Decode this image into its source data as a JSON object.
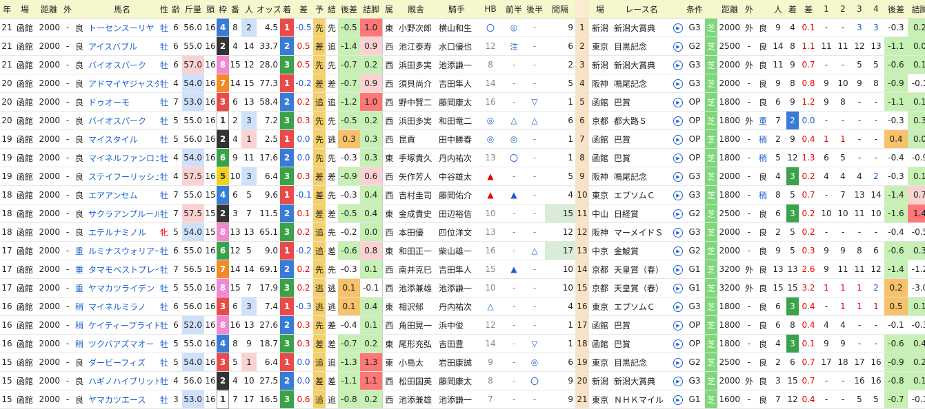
{
  "headers": [
    "年",
    "場",
    "距離",
    "外",
    "",
    "馬名",
    "性",
    "齢",
    "斤量",
    "頭",
    "枠",
    "番",
    "人",
    "オッズ",
    "着",
    "差",
    "予",
    "結",
    "後差",
    "詰脚",
    "属",
    "厩舎",
    "騎手",
    "HB",
    "前半",
    "後半",
    "間隔",
    "",
    "場",
    "レース名",
    "",
    "条件",
    "",
    "距離",
    "外",
    "",
    "人",
    "着",
    "差",
    "1",
    "2",
    "3",
    "4",
    "後差",
    "詰脚"
  ],
  "colors": {
    "waku": {
      "1": "#ffffff",
      "2": "#333333",
      "3": "#e94b4b",
      "4": "#3a7bd5",
      "5": "#f2d21b",
      "6": "#3aa34a",
      "7": "#f08a2a",
      "8": "#f08ad0"
    },
    "chaku": {
      "1": "#e94b4b",
      "2": "#3a7bd5",
      "3": "#3aa34a"
    }
  },
  "rows": [
    {
      "yr": "21",
      "ba": "函館",
      "dist": "2000",
      "soto": "-",
      "baba": "良",
      "name": "トーセンスーリヤ",
      "sex": "牡",
      "age": "6",
      "kin": "56.0",
      "tou": "16",
      "waku": "4",
      "ban": "8",
      "nin": "2",
      "odds": "4.5",
      "chaku": "1",
      "sa": "-0.5",
      "yoso": "先",
      "kek": "先",
      "kosa": "-0.5",
      "tume": "1.0",
      "zoku": "東",
      "kyu": "小野次郎",
      "kishu": "横山和生",
      "hb": "〇",
      "zen": "◎",
      "kou": "-",
      "kan": "9",
      "no": "1",
      "ba2": "新潟",
      "race": "新潟大賞典",
      "jo": "G3",
      "shiba": "芝",
      "dist2": "2000",
      "soto2": "外",
      "baba2": "良",
      "nin2": "9",
      "chaku2": "4",
      "sa2": "0.1",
      "c1": "-",
      "c2": "-",
      "c3": "3",
      "c4": "3",
      "kosa2": "-0.3",
      "tume2": "0.2"
    },
    {
      "yr": "21",
      "ba": "函館",
      "dist": "2000",
      "soto": "-",
      "baba": "良",
      "name": "アイスバブル",
      "sex": "牡",
      "age": "6",
      "kin": "55.0",
      "tou": "16",
      "waku": "2",
      "ban": "4",
      "nin": "14",
      "odds": "33.7",
      "chaku": "2",
      "sa": "0.5",
      "yoso": "差",
      "kek": "追",
      "kosa": "-1.4",
      "tume": "0.9",
      "zoku": "西",
      "kyu": "池江泰寿",
      "kishu": "水口優也",
      "hb": "12",
      "zen": "注",
      "kou": "-",
      "kan": "6",
      "no": "2",
      "ba2": "東京",
      "race": "目黒記念",
      "jo": "G2",
      "shiba": "芝",
      "dist2": "2500",
      "soto2": "-",
      "baba2": "良",
      "nin2": "14",
      "chaku2": "8",
      "sa2": "1.1",
      "c1": "11",
      "c2": "11",
      "c3": "12",
      "c4": "13",
      "kosa2": "-1.1",
      "tume2": "0.0"
    },
    {
      "yr": "21",
      "ba": "函館",
      "dist": "2000",
      "soto": "-",
      "baba": "良",
      "name": "バイオスパーク",
      "sex": "牡",
      "age": "6",
      "kin": "57.0",
      "tou": "16",
      "waku": "8",
      "ban": "15",
      "nin": "12",
      "odds": "28.0",
      "chaku": "3",
      "sa": "0.5",
      "yoso": "先",
      "kek": "先",
      "kosa": "-0.7",
      "tume": "0.2",
      "zoku": "西",
      "kyu": "浜田多実",
      "kishu": "池添謙一",
      "hb": "8",
      "zen": "-",
      "kou": "-",
      "kan": "2",
      "no": "3",
      "ba2": "新潟",
      "race": "新潟大賞典",
      "jo": "G3",
      "shiba": "芝",
      "dist2": "2000",
      "soto2": "外",
      "baba2": "良",
      "nin2": "11",
      "chaku2": "9",
      "sa2": "0.7",
      "c1": "-",
      "c2": "-",
      "c3": "5",
      "c4": "5",
      "kosa2": "-0.6",
      "tume2": "0.1"
    },
    {
      "yr": "20",
      "ba": "函館",
      "dist": "2000",
      "soto": "-",
      "baba": "良",
      "name": "アドマイヤジャスタ",
      "sex": "牡",
      "age": "4",
      "kin": "54.0",
      "tou": "16",
      "waku": "7",
      "ban": "14",
      "nin": "15",
      "odds": "77.3",
      "chaku": "1",
      "sa": "-0.2",
      "yoso": "差",
      "kek": "差",
      "kosa": "-0.7",
      "tume": "0.9",
      "zoku": "西",
      "kyu": "須貝尚介",
      "kishu": "吉田隼人",
      "hb": "14",
      "zen": "-",
      "kou": "-",
      "kan": "5",
      "no": "4",
      "ba2": "阪神",
      "race": "鳴尾記念",
      "jo": "G3",
      "shiba": "芝",
      "dist2": "2000",
      "soto2": "-",
      "baba2": "良",
      "nin2": "9",
      "chaku2": "8",
      "sa2": "0.8",
      "c1": "9",
      "c2": "10",
      "c3": "9",
      "c4": "8",
      "kosa2": "-0.9",
      "tume2": "-0.1"
    },
    {
      "yr": "20",
      "ba": "函館",
      "dist": "2000",
      "soto": "-",
      "baba": "良",
      "name": "ドゥオーモ",
      "sex": "牡",
      "age": "7",
      "kin": "53.0",
      "tou": "16",
      "waku": "3",
      "ban": "6",
      "nin": "13",
      "odds": "58.4",
      "chaku": "2",
      "sa": "0.2",
      "yoso": "追",
      "kek": "追",
      "kosa": "-1.2",
      "tume": "1.0",
      "zoku": "西",
      "kyu": "野中賢二",
      "kishu": "藤岡康太",
      "hb": "16",
      "zen": "-",
      "kou": "▽",
      "kan": "1",
      "no": "5",
      "ba2": "函館",
      "race": "巴賞",
      "jo": "OP",
      "shiba": "芝",
      "dist2": "1800",
      "soto2": "-",
      "baba2": "良",
      "nin2": "6",
      "chaku2": "9",
      "sa2": "1.2",
      "c1": "9",
      "c2": "8",
      "c3": "-",
      "c4": "-",
      "kosa2": "-1.1",
      "tume2": "0.1"
    },
    {
      "yr": "20",
      "ba": "函館",
      "dist": "2000",
      "soto": "-",
      "baba": "良",
      "name": "バイオスパーク",
      "sex": "牡",
      "age": "5",
      "kin": "55.0",
      "tou": "16",
      "waku": "1",
      "ban": "2",
      "nin": "3",
      "odds": "7.2",
      "chaku": "3",
      "sa": "0.3",
      "yoso": "先",
      "kek": "先",
      "kosa": "-0.5",
      "tume": "0.2",
      "zoku": "西",
      "kyu": "浜田多実",
      "kishu": "和田竜二",
      "hb": "◎",
      "zen": "△",
      "kou": "△",
      "kan": "6",
      "no": "6",
      "ba2": "京都",
      "race": "都大路Ｓ",
      "jo": "OP",
      "shiba": "芝",
      "dist2": "1800",
      "soto2": "外",
      "baba2": "重",
      "nin2": "7",
      "chaku2": "2",
      "sa2": "0.0",
      "c1": "-",
      "c2": "-",
      "c3": "-",
      "c4": "-",
      "kosa2": "-0.3",
      "tume2": "0.3"
    },
    {
      "yr": "19",
      "ba": "函館",
      "dist": "2000",
      "soto": "-",
      "baba": "良",
      "name": "マイスタイル",
      "sex": "牡",
      "age": "5",
      "kin": "56.0",
      "tou": "16",
      "waku": "2",
      "ban": "4",
      "nin": "1",
      "odds": "2.5",
      "chaku": "1",
      "sa": "0.0",
      "yoso": "先",
      "kek": "逃",
      "kosa": "0.3",
      "tume": "0.3",
      "zoku": "西",
      "kyu": "昆貢",
      "kishu": "田中勝春",
      "hb": "◎",
      "zen": "◎",
      "kou": "-",
      "kan": "1",
      "no": "7",
      "ba2": "函館",
      "race": "巴賞",
      "jo": "OP",
      "shiba": "芝",
      "dist2": "1800",
      "soto2": "-",
      "baba2": "稍",
      "nin2": "2",
      "chaku2": "9",
      "sa2": "0.4",
      "c1": "1",
      "c2": "1",
      "c3": "-",
      "c4": "-",
      "kosa2": "0.4",
      "tume2": "0.0"
    },
    {
      "yr": "19",
      "ba": "函館",
      "dist": "2000",
      "soto": "-",
      "baba": "良",
      "name": "マイネルファンロン",
      "sex": "牡",
      "age": "4",
      "kin": "54.0",
      "tou": "16",
      "waku": "6",
      "ban": "9",
      "nin": "11",
      "odds": "17.6",
      "chaku": "2",
      "sa": "0.0",
      "yoso": "先",
      "kek": "先",
      "kosa": "-0.3",
      "tume": "0.3",
      "zoku": "東",
      "kyu": "手塚貴久",
      "kishu": "丹内祐次",
      "hb": "13",
      "zen": "〇",
      "kou": "-",
      "kan": "1",
      "no": "8",
      "ba2": "函館",
      "race": "巴賞",
      "jo": "OP",
      "shiba": "芝",
      "dist2": "1800",
      "soto2": "-",
      "baba2": "稍",
      "nin2": "5",
      "chaku2": "12",
      "sa2": "1.3",
      "c1": "6",
      "c2": "5",
      "c3": "-",
      "c4": "-",
      "kosa2": "-0.4",
      "tume2": "-0.9"
    },
    {
      "yr": "19",
      "ba": "函館",
      "dist": "2000",
      "soto": "-",
      "baba": "良",
      "name": "ステイフーリッシュ",
      "sex": "牡",
      "age": "4",
      "kin": "57.5",
      "tou": "16",
      "waku": "5",
      "ban": "10",
      "nin": "3",
      "odds": "6.4",
      "chaku": "3",
      "sa": "0.3",
      "yoso": "差",
      "kek": "差",
      "kosa": "-0.9",
      "tume": "0.6",
      "zoku": "西",
      "kyu": "矢作芳人",
      "kishu": "中谷雄太",
      "hb": "▲",
      "zen": "-",
      "kou": "-",
      "kan": "5",
      "no": "9",
      "ba2": "阪神",
      "race": "鳴尾記念",
      "jo": "G3",
      "shiba": "芝",
      "dist2": "2000",
      "soto2": "-",
      "baba2": "良",
      "nin2": "4",
      "chaku2": "3",
      "sa2": "0.2",
      "c1": "4",
      "c2": "4",
      "c3": "4",
      "c4": "2",
      "kosa2": "-0.3",
      "tume2": "0.1"
    },
    {
      "yr": "18",
      "ba": "函館",
      "dist": "2000",
      "soto": "-",
      "baba": "良",
      "name": "エアアンセム",
      "sex": "牡",
      "age": "7",
      "kin": "55.0",
      "tou": "15",
      "waku": "4",
      "ban": "6",
      "nin": "5",
      "odds": "9.6",
      "chaku": "1",
      "sa": "-0.1",
      "yoso": "差",
      "kek": "先",
      "kosa": "-0.3",
      "tume": "0.4",
      "zoku": "西",
      "kyu": "吉村圭司",
      "kishu": "藤岡佑介",
      "hb": "▲",
      "zen": "▲",
      "kou": "-",
      "kan": "4",
      "no": "10",
      "ba2": "東京",
      "race": "エプソムＣ",
      "jo": "G3",
      "shiba": "芝",
      "dist2": "1800",
      "soto2": "-",
      "baba2": "稍",
      "nin2": "8",
      "chaku2": "5",
      "sa2": "0.7",
      "c1": "-",
      "c2": "7",
      "c3": "13",
      "c4": "14",
      "kosa2": "-1.4",
      "tume2": "0.7"
    },
    {
      "yr": "18",
      "ba": "函館",
      "dist": "2000",
      "soto": "-",
      "baba": "良",
      "name": "サクラアンプルール",
      "sex": "牡",
      "age": "7",
      "kin": "57.5",
      "tou": "15",
      "waku": "2",
      "ban": "3",
      "nin": "7",
      "odds": "11.5",
      "chaku": "2",
      "sa": "0.1",
      "yoso": "差",
      "kek": "差",
      "kosa": "-0.5",
      "tume": "0.4",
      "zoku": "東",
      "kyu": "金成貴史",
      "kishu": "田辺裕信",
      "hb": "10",
      "zen": "-",
      "kou": "-",
      "kan": "15",
      "no": "11",
      "ba2": "中山",
      "race": "日経賞",
      "jo": "G2",
      "shiba": "芝",
      "dist2": "2500",
      "soto2": "-",
      "baba2": "良",
      "nin2": "6",
      "chaku2": "3",
      "sa2": "0.2",
      "c1": "10",
      "c2": "10",
      "c3": "11",
      "c4": "10",
      "kosa2": "-1.6",
      "tume2": "1.4"
    },
    {
      "yr": "18",
      "ba": "函館",
      "dist": "2000",
      "soto": "-",
      "baba": "良",
      "name": "エテルナミノル",
      "sex": "牝",
      "age": "5",
      "kin": "54.0",
      "tou": "15",
      "waku": "8",
      "ban": "13",
      "nin": "13",
      "odds": "65.1",
      "chaku": "3",
      "sa": "0.2",
      "yoso": "追",
      "kek": "先",
      "kosa": "-0.2",
      "tume": "0.0",
      "zoku": "西",
      "kyu": "本田優",
      "kishu": "四位洋文",
      "hb": "13",
      "zen": "-",
      "kou": "-",
      "kan": "12",
      "no": "12",
      "ba2": "阪神",
      "race": "マーメイドＳ",
      "jo": "G3",
      "shiba": "芝",
      "dist2": "2000",
      "soto2": "-",
      "baba2": "良",
      "nin2": "2",
      "chaku2": "5",
      "sa2": "0.2",
      "c1": "-",
      "c2": "-",
      "c3": "-",
      "c4": "-",
      "kosa2": "-0.4",
      "tume2": "-0.5"
    },
    {
      "yr": "17",
      "ba": "函館",
      "dist": "2000",
      "soto": "-",
      "baba": "重",
      "name": "ルミナスウォリアー",
      "sex": "牡",
      "age": "6",
      "kin": "55.0",
      "tou": "16",
      "waku": "6",
      "ban": "12",
      "nin": "5",
      "odds": "9.0",
      "chaku": "1",
      "sa": "-0.2",
      "yoso": "追",
      "kek": "差",
      "kosa": "-0.6",
      "tume": "0.8",
      "zoku": "東",
      "kyu": "和田正一",
      "kishu": "柴山雄一",
      "hb": "16",
      "zen": "-",
      "kou": "△",
      "kan": "17",
      "no": "13",
      "ba2": "中京",
      "race": "金鯱賞",
      "jo": "G2",
      "shiba": "芝",
      "dist2": "2000",
      "soto2": "-",
      "baba2": "良",
      "nin2": "9",
      "chaku2": "5",
      "sa2": "0.3",
      "c1": "9",
      "c2": "9",
      "c3": "8",
      "c4": "6",
      "kosa2": "-0.6",
      "tume2": "0.3"
    },
    {
      "yr": "17",
      "ba": "函館",
      "dist": "2000",
      "soto": "-",
      "baba": "重",
      "name": "タマモベストプレイ",
      "sex": "牡",
      "age": "7",
      "kin": "56.5",
      "tou": "16",
      "waku": "7",
      "ban": "14",
      "nin": "14",
      "odds": "69.1",
      "chaku": "2",
      "sa": "0.2",
      "yoso": "先",
      "kek": "先",
      "kosa": "-0.3",
      "tume": "0.1",
      "zoku": "西",
      "kyu": "南井克巳",
      "kishu": "吉田隼人",
      "hb": "15",
      "zen": "▲",
      "kou": "-",
      "kan": "10",
      "no": "14",
      "ba2": "京都",
      "race": "天皇賞（春）",
      "jo": "G1",
      "shiba": "芝",
      "dist2": "3200",
      "soto2": "外",
      "baba2": "良",
      "nin2": "13",
      "chaku2": "13",
      "sa2": "2.6",
      "c1": "9",
      "c2": "11",
      "c3": "11",
      "c4": "12",
      "kosa2": "-1.4",
      "tume2": "-1.2"
    },
    {
      "yr": "17",
      "ba": "函館",
      "dist": "2000",
      "soto": "-",
      "baba": "重",
      "name": "ヤマカツライデン",
      "sex": "牡",
      "age": "5",
      "kin": "55.0",
      "tou": "16",
      "waku": "8",
      "ban": "15",
      "nin": "7",
      "odds": "17.9",
      "chaku": "3",
      "sa": "0.2",
      "yoso": "逃",
      "kek": "逃",
      "kosa": "0.1",
      "tume": "-0.1",
      "zoku": "西",
      "kyu": "池添兼雄",
      "kishu": "池添謙一",
      "hb": "10",
      "zen": "-",
      "kou": "-",
      "kan": "10",
      "no": "15",
      "ba2": "京都",
      "race": "天皇賞（春）",
      "jo": "G1",
      "shiba": "芝",
      "dist2": "3200",
      "soto2": "外",
      "baba2": "良",
      "nin2": "15",
      "chaku2": "15",
      "sa2": "3.2",
      "c1": "1",
      "c2": "1",
      "c3": "1",
      "c4": "2",
      "kosa2": "0.2",
      "tume2": "-3.0"
    },
    {
      "yr": "16",
      "ba": "函館",
      "dist": "2000",
      "soto": "-",
      "baba": "稍",
      "name": "マイネルミラノ",
      "sex": "牡",
      "age": "6",
      "kin": "56.0",
      "tou": "16",
      "waku": "3",
      "ban": "6",
      "nin": "3",
      "odds": "7.4",
      "chaku": "1",
      "sa": "-0.3",
      "yoso": "逃",
      "kek": "逃",
      "kosa": "0.1",
      "tume": "0.4",
      "zoku": "東",
      "kyu": "相沢郁",
      "kishu": "丹内祐次",
      "hb": "△",
      "zen": "-",
      "kou": "-",
      "kan": "4",
      "no": "16",
      "ba2": "東京",
      "race": "エプソムＣ",
      "jo": "G3",
      "shiba": "芝",
      "dist2": "1800",
      "soto2": "-",
      "baba2": "良",
      "nin2": "6",
      "chaku2": "3",
      "sa2": "0.4",
      "c1": "-",
      "c2": "1",
      "c3": "1",
      "c4": "1",
      "kosa2": "0.5",
      "tume2": "0.1"
    },
    {
      "yr": "16",
      "ba": "函館",
      "dist": "2000",
      "soto": "-",
      "baba": "稍",
      "name": "ケイティープライド",
      "sex": "牡",
      "age": "6",
      "kin": "52.0",
      "tou": "16",
      "waku": "8",
      "ban": "16",
      "nin": "13",
      "odds": "27.6",
      "chaku": "2",
      "sa": "0.3",
      "yoso": "先",
      "kek": "差",
      "kosa": "-0.4",
      "tume": "0.1",
      "zoku": "西",
      "kyu": "角田晃一",
      "kishu": "浜中俊",
      "hb": "12",
      "zen": "-",
      "kou": "-",
      "kan": "1",
      "no": "17",
      "ba2": "函館",
      "race": "巴賞",
      "jo": "OP",
      "shiba": "芝",
      "dist2": "1800",
      "soto2": "-",
      "baba2": "良",
      "nin2": "6",
      "chaku2": "8",
      "sa2": "0.4",
      "c1": "4",
      "c2": "4",
      "c3": "-",
      "c4": "-",
      "kosa2": "-0.1",
      "tume2": "-0.3"
    },
    {
      "yr": "16",
      "ba": "函館",
      "dist": "2000",
      "soto": "-",
      "baba": "稍",
      "name": "ツクバアズマオー",
      "sex": "牡",
      "age": "5",
      "kin": "55.0",
      "tou": "16",
      "waku": "4",
      "ban": "8",
      "nin": "9",
      "odds": "18.7",
      "chaku": "3",
      "sa": "0.3",
      "yoso": "差",
      "kek": "差",
      "kosa": "-0.7",
      "tume": "0.2",
      "zoku": "東",
      "kyu": "尾形充弘",
      "kishu": "吉田豊",
      "hb": "14",
      "zen": "-",
      "kou": "▽",
      "kan": "1",
      "no": "18",
      "ba2": "函館",
      "race": "巴賞",
      "jo": "OP",
      "shiba": "芝",
      "dist2": "1800",
      "soto2": "-",
      "baba2": "良",
      "nin2": "4",
      "chaku2": "3",
      "sa2": "0.1",
      "c1": "9",
      "c2": "9",
      "c3": "-",
      "c4": "-",
      "kosa2": "-0.6",
      "tume2": "0.4"
    },
    {
      "yr": "15",
      "ba": "函館",
      "dist": "2000",
      "soto": "-",
      "baba": "良",
      "name": "ダービーフィズ",
      "sex": "牡",
      "age": "5",
      "kin": "54.0",
      "tou": "16",
      "waku": "3",
      "ban": "5",
      "nin": "1",
      "odds": "6.4",
      "chaku": "1",
      "sa": "0.0",
      "yoso": "追",
      "kek": "追",
      "kosa": "-1.3",
      "tume": "1.3",
      "zoku": "東",
      "kyu": "小島太",
      "kishu": "岩田康誠",
      "hb": "9",
      "zen": "-",
      "kou": "◎",
      "kan": "6",
      "no": "19",
      "ba2": "東京",
      "race": "目黒記念",
      "jo": "G2",
      "shiba": "芝",
      "dist2": "2500",
      "soto2": "-",
      "baba2": "良",
      "nin2": "2",
      "chaku2": "6",
      "sa2": "0.7",
      "c1": "17",
      "c2": "18",
      "c3": "17",
      "c4": "16",
      "kosa2": "-0.9",
      "tume2": "0.2"
    },
    {
      "yr": "15",
      "ba": "函館",
      "dist": "2000",
      "soto": "-",
      "baba": "良",
      "name": "ハギノハイブリッド",
      "sex": "牡",
      "age": "4",
      "kin": "56.0",
      "tou": "16",
      "waku": "2",
      "ban": "4",
      "nin": "10",
      "odds": "27.5",
      "chaku": "2",
      "sa": "0.0",
      "yoso": "差",
      "kek": "差",
      "kosa": "-1.1",
      "tume": "1.1",
      "zoku": "西",
      "kyu": "松田国英",
      "kishu": "藤岡康太",
      "hb": "8",
      "zen": "-",
      "kou": "〇",
      "kan": "9",
      "no": "20",
      "ba2": "新潟",
      "race": "新潟大賞典",
      "jo": "G3",
      "shiba": "芝",
      "dist2": "2000",
      "soto2": "外",
      "baba2": "良",
      "nin2": "3",
      "chaku2": "15",
      "sa2": "0.7",
      "c1": "-",
      "c2": "-",
      "c3": "16",
      "c4": "16",
      "kosa2": "-0.8",
      "tume2": "0.1"
    },
    {
      "yr": "15",
      "ba": "函館",
      "dist": "2000",
      "soto": "-",
      "baba": "良",
      "name": "ヤマカツエース",
      "sex": "牡",
      "age": "3",
      "kin": "53.0",
      "tou": "16",
      "waku": "1",
      "ban": "7",
      "nin": "17",
      "odds": "16.5",
      "chaku": "3",
      "sa": "0.6",
      "yoso": "追",
      "kek": "追",
      "kosa": "-0.8",
      "tume": "0.2",
      "zoku": "西",
      "kyu": "池添兼雄",
      "kishu": "池添謙一",
      "hb": "7",
      "zen": "-",
      "kou": "-",
      "kan": "9",
      "no": "21",
      "ba2": "東京",
      "race": "ＮＨＫマイル",
      "jo": "G1",
      "shiba": "芝",
      "dist2": "1600",
      "soto2": "-",
      "baba2": "良",
      "nin2": "7",
      "chaku2": "12",
      "sa2": "0.4",
      "c1": "-",
      "c2": "-",
      "c3": "5",
      "c4": "5",
      "kosa2": "-0.7",
      "tume2": "-0.1"
    }
  ]
}
